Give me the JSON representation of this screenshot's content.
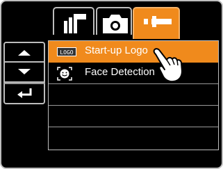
{
  "tabs": [
    {
      "name": "mode",
      "icon": "mode-select-icon",
      "active": false
    },
    {
      "name": "camera",
      "icon": "camera-icon",
      "active": false
    },
    {
      "name": "setup",
      "icon": "wrench-icon",
      "active": true
    }
  ],
  "side_buttons": [
    {
      "icon": "arrow-up-icon"
    },
    {
      "icon": "arrow-down-icon"
    },
    {
      "icon": "enter-return-icon"
    }
  ],
  "menu": {
    "items": [
      {
        "label": "Start-up Logo",
        "icon": "logo-icon",
        "icon_text": "LOGO",
        "selected": true
      },
      {
        "label": "Face Detection",
        "icon": "face-detection-icon",
        "selected": false
      }
    ],
    "empty_rows": 3
  },
  "colors": {
    "accent": "#f08a1c",
    "background": "#000000",
    "border": "#bdbdbd",
    "text": "#ffffff"
  },
  "pointer_icon": "hand-pointer-icon"
}
